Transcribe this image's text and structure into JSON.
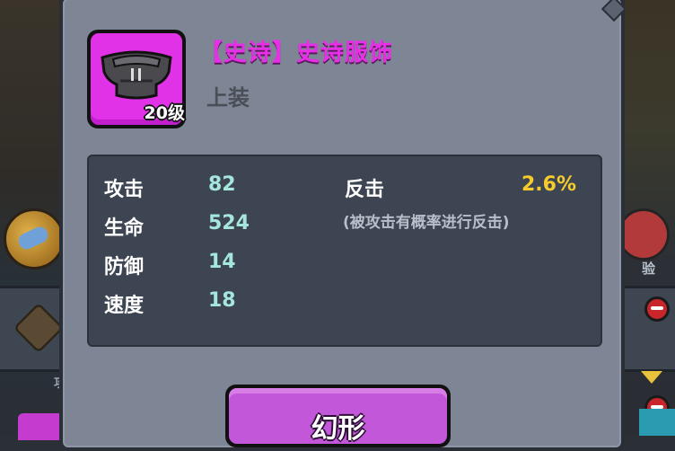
{
  "item": {
    "title": "【史诗】史诗服饰",
    "type": "上装",
    "level": "20级",
    "rarity_color": "#e232e8",
    "icon": "armor-shirt-icon"
  },
  "stats": [
    {
      "label": "攻击",
      "value": "82"
    },
    {
      "label": "生命",
      "value": "524"
    },
    {
      "label": "防御",
      "value": "14"
    },
    {
      "label": "速度",
      "value": "18"
    }
  ],
  "special": {
    "label": "反击",
    "value": "2.6%",
    "description": "(被攻击有概率进行反击)",
    "value_color": "#f6cc2c"
  },
  "actions": {
    "transform_label": "幻形",
    "button_color": "#c257d9"
  },
  "background": {
    "left_char": "攻",
    "right_char": "验"
  }
}
